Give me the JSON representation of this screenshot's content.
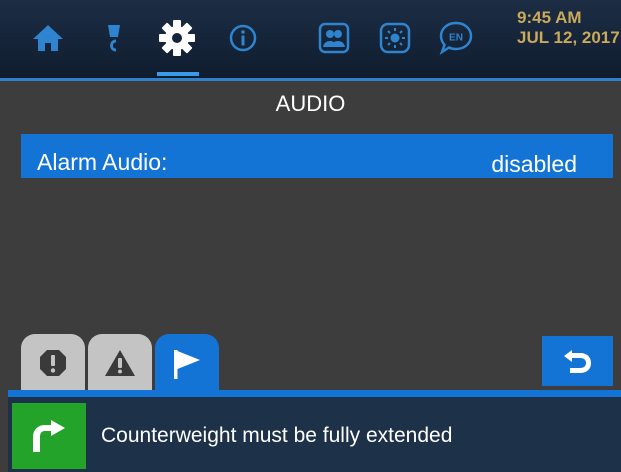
{
  "colors": {
    "nav_background": "#15243a",
    "nav_icon": "#2f84cf",
    "nav_icon_active": "#ffffff",
    "accent_blue": "#1474d6",
    "clock_text": "#c9a95a",
    "screen_background": "#3d3d3d",
    "tab_inactive": "#c4c4c4",
    "message_bar": "#1d3149",
    "message_icon": "#24a32a"
  },
  "nav": {
    "active": "settings",
    "items": [
      {
        "id": "home",
        "icon": "home-icon"
      },
      {
        "id": "lamp",
        "icon": "lamp-icon"
      },
      {
        "id": "settings",
        "icon": "gear-icon"
      },
      {
        "id": "info",
        "icon": "info-icon"
      },
      {
        "id": "users",
        "icon": "users-icon"
      },
      {
        "id": "brightness",
        "icon": "brightness-icon"
      },
      {
        "id": "language",
        "icon": "language-icon",
        "label": "EN"
      }
    ]
  },
  "clock": {
    "time": "9:45 AM",
    "date": "JUL 12, 2017"
  },
  "page": {
    "title": "AUDIO"
  },
  "settings": [
    {
      "label": "Alarm Audio:",
      "value": "disabled",
      "selected": true
    }
  ],
  "tabs": [
    {
      "id": "critical",
      "icon": "octagon-exclamation-icon",
      "active": false
    },
    {
      "id": "warning",
      "icon": "triangle-warning-icon",
      "active": false
    },
    {
      "id": "notice",
      "icon": "flag-icon",
      "active": true
    }
  ],
  "back_button": {
    "icon": "back-arrow-icon"
  },
  "message": {
    "icon": "turn-arrow-icon",
    "text": "Counterweight must be fully extended"
  }
}
